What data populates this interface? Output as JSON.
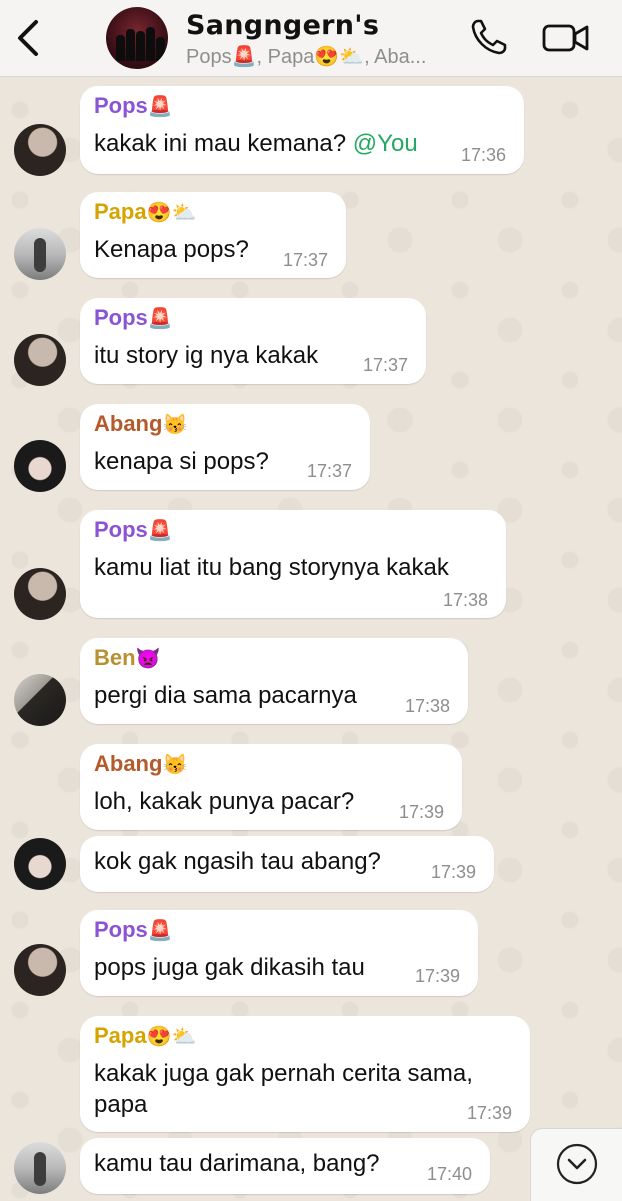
{
  "header": {
    "title": "Sangngern's",
    "subtitle": "Pops🚨, Papa😍⛅, Aba..."
  },
  "messages": [
    {
      "sender": "Pops",
      "sender_emoji": "🚨",
      "text": "kakak ini mau kemana? ",
      "mention": "@You",
      "time": "17:36"
    },
    {
      "sender": "Papa",
      "sender_emoji": "😍⛅",
      "text": "Kenapa pops?",
      "time": "17:37"
    },
    {
      "sender": "Pops",
      "sender_emoji": "🚨",
      "text": "itu story ig nya kakak",
      "time": "17:37"
    },
    {
      "sender": "Abang",
      "sender_emoji": "😽",
      "text": "kenapa si pops?",
      "time": "17:37"
    },
    {
      "sender": "Pops",
      "sender_emoji": "🚨",
      "text": "kamu liat itu bang storynya kakak",
      "time": "17:38"
    },
    {
      "sender": "Ben",
      "sender_emoji": "👿",
      "text": "pergi dia sama pacarnya",
      "time": "17:38"
    },
    {
      "sender": "Abang",
      "sender_emoji": "😽",
      "text": "loh, kakak punya pacar?",
      "time": "17:39"
    },
    {
      "text": "kok gak ngasih tau abang?",
      "time": "17:39"
    },
    {
      "sender": "Pops",
      "sender_emoji": "🚨",
      "text": "pops juga gak dikasih tau",
      "time": "17:39"
    },
    {
      "sender": "Papa",
      "sender_emoji": "😍⛅",
      "text": "kakak juga gak pernah cerita sama,",
      "text2": "papa",
      "time": "17:39"
    },
    {
      "text": "kamu tau darimana, bang?",
      "time": "17:40"
    }
  ],
  "colors": {
    "pops": "#8a54d4",
    "papa": "#d6a400",
    "abang": "#b45a2b",
    "ben": "#b89130",
    "mention": "#25a863",
    "background": "#ece5dc"
  },
  "icons": {
    "back": "chevron-left-icon",
    "call": "phone-icon",
    "video": "video-camera-icon",
    "scroll": "chevron-down-circle-icon"
  }
}
